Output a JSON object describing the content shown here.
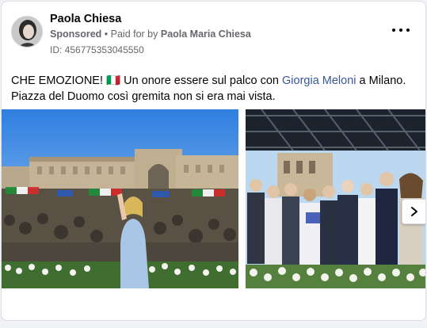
{
  "post": {
    "author": "Paola Chiesa",
    "sponsored_label": "Sponsored",
    "separator": " • ",
    "paid_for_prefix": "Paid for by ",
    "paid_for_name": "Paola Maria Chiesa",
    "ad_id": "ID: 456775353045550",
    "text_part1": "CHE EMOZIONE! 🇮🇹 Un onore essere sul palco con ",
    "text_link": "Giorgia Meloni",
    "text_part2": " a Milano. Piazza del Duomo così gremita non si era mai vista."
  },
  "icons": {
    "more": "more-options-icon",
    "next": "chevron-right-icon"
  },
  "colors": {
    "link": "#385898",
    "secondary_text": "#65676b",
    "card_border": "#dadde1"
  }
}
